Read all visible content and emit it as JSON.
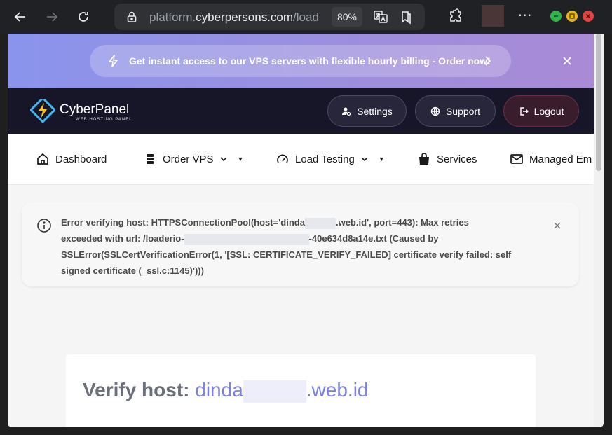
{
  "browser": {
    "url_host": "platform.",
    "url_domain": "cyberpersons.com",
    "url_path": "/load",
    "zoom": "80%",
    "more": "⋯"
  },
  "promo": {
    "text": "Get instant access to our VPS servers with flexible hourly billing - Order now!"
  },
  "header": {
    "brand": "CyberPanel",
    "brand_sub": "WEB HOSTING PANEL",
    "settings_label": "Settings",
    "support_label": "Support",
    "logout_label": "Logout"
  },
  "menu": {
    "items": [
      {
        "label": "Dashboard"
      },
      {
        "label": "Order VPS"
      },
      {
        "label": "Load Testing"
      },
      {
        "label": "Services"
      },
      {
        "label": "Managed Em"
      }
    ]
  },
  "alert": {
    "line1_a": "Error verifying host: HTTPSConnectionPool(host='dinda",
    "line1_b": ".web.id', port=443): Max retries",
    "line2_a": "exceeded with url: /loaderio-",
    "line2_b": "-40e634d8a14e.txt (Caused by",
    "line3": "SSLError(SSLCertVerificationError(1, '[SSL: CERTIFICATE_VERIFY_FAILED] certificate verify failed: self",
    "line4": "signed certificate (_ssl.c:1145)')))"
  },
  "verify": {
    "label": "Verify host:",
    "host_start": "dinda",
    "host_end": ".web.id"
  },
  "colors": {
    "accent": "#7b80e6",
    "header_bg": "#171629",
    "logout_bg": "#3a1d2d"
  }
}
